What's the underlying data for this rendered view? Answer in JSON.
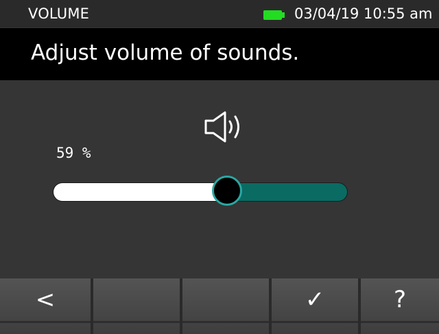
{
  "status_bar": {
    "title": "VOLUME",
    "datetime": "03/04/19 10:55 am",
    "battery_icon": "battery-full-icon",
    "battery_color": "#22dd22"
  },
  "prompt": {
    "text": "Adjust volume of sounds."
  },
  "volume": {
    "icon": "speaker-icon",
    "percent_label": "59 %",
    "value": 59,
    "max": 100,
    "fill_color": "#ffffff",
    "track_color": "#0a6b63",
    "thumb_ring_color": "#2aa7a2"
  },
  "softkeys": [
    {
      "icon": "chevron-left-icon",
      "glyph": "<"
    },
    {
      "icon": "",
      "glyph": ""
    },
    {
      "icon": "",
      "glyph": ""
    },
    {
      "icon": "checkmark-icon",
      "glyph": "✓"
    },
    {
      "icon": "help-icon",
      "glyph": "?"
    }
  ]
}
